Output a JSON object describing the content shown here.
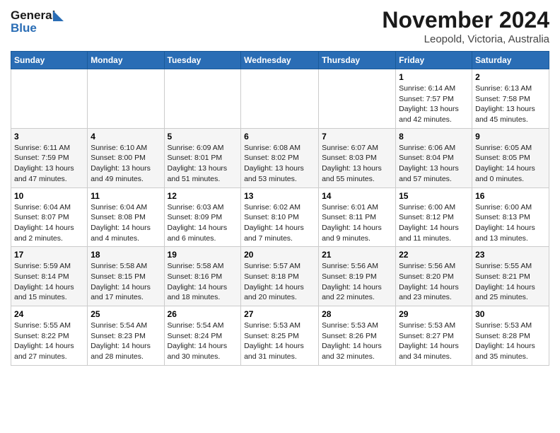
{
  "logo": {
    "line1": "General",
    "line2": "Blue"
  },
  "header": {
    "month": "November 2024",
    "location": "Leopold, Victoria, Australia"
  },
  "weekdays": [
    "Sunday",
    "Monday",
    "Tuesday",
    "Wednesday",
    "Thursday",
    "Friday",
    "Saturday"
  ],
  "weeks": [
    [
      {
        "day": "",
        "info": ""
      },
      {
        "day": "",
        "info": ""
      },
      {
        "day": "",
        "info": ""
      },
      {
        "day": "",
        "info": ""
      },
      {
        "day": "",
        "info": ""
      },
      {
        "day": "1",
        "info": "Sunrise: 6:14 AM\nSunset: 7:57 PM\nDaylight: 13 hours\nand 42 minutes."
      },
      {
        "day": "2",
        "info": "Sunrise: 6:13 AM\nSunset: 7:58 PM\nDaylight: 13 hours\nand 45 minutes."
      }
    ],
    [
      {
        "day": "3",
        "info": "Sunrise: 6:11 AM\nSunset: 7:59 PM\nDaylight: 13 hours\nand 47 minutes."
      },
      {
        "day": "4",
        "info": "Sunrise: 6:10 AM\nSunset: 8:00 PM\nDaylight: 13 hours\nand 49 minutes."
      },
      {
        "day": "5",
        "info": "Sunrise: 6:09 AM\nSunset: 8:01 PM\nDaylight: 13 hours\nand 51 minutes."
      },
      {
        "day": "6",
        "info": "Sunrise: 6:08 AM\nSunset: 8:02 PM\nDaylight: 13 hours\nand 53 minutes."
      },
      {
        "day": "7",
        "info": "Sunrise: 6:07 AM\nSunset: 8:03 PM\nDaylight: 13 hours\nand 55 minutes."
      },
      {
        "day": "8",
        "info": "Sunrise: 6:06 AM\nSunset: 8:04 PM\nDaylight: 13 hours\nand 57 minutes."
      },
      {
        "day": "9",
        "info": "Sunrise: 6:05 AM\nSunset: 8:05 PM\nDaylight: 14 hours\nand 0 minutes."
      }
    ],
    [
      {
        "day": "10",
        "info": "Sunrise: 6:04 AM\nSunset: 8:07 PM\nDaylight: 14 hours\nand 2 minutes."
      },
      {
        "day": "11",
        "info": "Sunrise: 6:04 AM\nSunset: 8:08 PM\nDaylight: 14 hours\nand 4 minutes."
      },
      {
        "day": "12",
        "info": "Sunrise: 6:03 AM\nSunset: 8:09 PM\nDaylight: 14 hours\nand 6 minutes."
      },
      {
        "day": "13",
        "info": "Sunrise: 6:02 AM\nSunset: 8:10 PM\nDaylight: 14 hours\nand 7 minutes."
      },
      {
        "day": "14",
        "info": "Sunrise: 6:01 AM\nSunset: 8:11 PM\nDaylight: 14 hours\nand 9 minutes."
      },
      {
        "day": "15",
        "info": "Sunrise: 6:00 AM\nSunset: 8:12 PM\nDaylight: 14 hours\nand 11 minutes."
      },
      {
        "day": "16",
        "info": "Sunrise: 6:00 AM\nSunset: 8:13 PM\nDaylight: 14 hours\nand 13 minutes."
      }
    ],
    [
      {
        "day": "17",
        "info": "Sunrise: 5:59 AM\nSunset: 8:14 PM\nDaylight: 14 hours\nand 15 minutes."
      },
      {
        "day": "18",
        "info": "Sunrise: 5:58 AM\nSunset: 8:15 PM\nDaylight: 14 hours\nand 17 minutes."
      },
      {
        "day": "19",
        "info": "Sunrise: 5:58 AM\nSunset: 8:16 PM\nDaylight: 14 hours\nand 18 minutes."
      },
      {
        "day": "20",
        "info": "Sunrise: 5:57 AM\nSunset: 8:18 PM\nDaylight: 14 hours\nand 20 minutes."
      },
      {
        "day": "21",
        "info": "Sunrise: 5:56 AM\nSunset: 8:19 PM\nDaylight: 14 hours\nand 22 minutes."
      },
      {
        "day": "22",
        "info": "Sunrise: 5:56 AM\nSunset: 8:20 PM\nDaylight: 14 hours\nand 23 minutes."
      },
      {
        "day": "23",
        "info": "Sunrise: 5:55 AM\nSunset: 8:21 PM\nDaylight: 14 hours\nand 25 minutes."
      }
    ],
    [
      {
        "day": "24",
        "info": "Sunrise: 5:55 AM\nSunset: 8:22 PM\nDaylight: 14 hours\nand 27 minutes."
      },
      {
        "day": "25",
        "info": "Sunrise: 5:54 AM\nSunset: 8:23 PM\nDaylight: 14 hours\nand 28 minutes."
      },
      {
        "day": "26",
        "info": "Sunrise: 5:54 AM\nSunset: 8:24 PM\nDaylight: 14 hours\nand 30 minutes."
      },
      {
        "day": "27",
        "info": "Sunrise: 5:53 AM\nSunset: 8:25 PM\nDaylight: 14 hours\nand 31 minutes."
      },
      {
        "day": "28",
        "info": "Sunrise: 5:53 AM\nSunset: 8:26 PM\nDaylight: 14 hours\nand 32 minutes."
      },
      {
        "day": "29",
        "info": "Sunrise: 5:53 AM\nSunset: 8:27 PM\nDaylight: 14 hours\nand 34 minutes."
      },
      {
        "day": "30",
        "info": "Sunrise: 5:53 AM\nSunset: 8:28 PM\nDaylight: 14 hours\nand 35 minutes."
      }
    ]
  ]
}
